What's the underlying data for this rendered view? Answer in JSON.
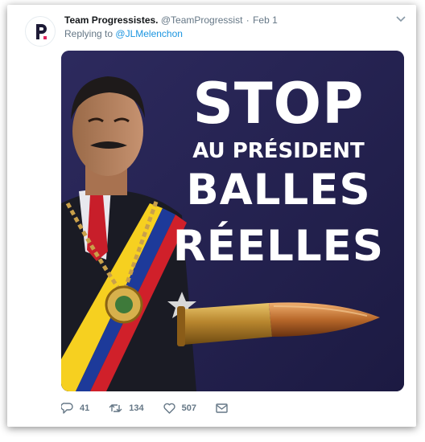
{
  "tweet": {
    "author_name": "Team Progressistes.",
    "handle": "@TeamProgressist",
    "separator": "·",
    "date": "Feb 1",
    "replying_prefix": "Replying to",
    "replying_to": "@JLMelenchon",
    "image_text": {
      "line1": "STOP",
      "line2": "AU PRÉSIDENT",
      "line3": "BALLES",
      "line4": "RÉELLES"
    },
    "actions": {
      "replies": "41",
      "retweets": "134",
      "likes": "507"
    }
  },
  "icons": {
    "avatar": "p-logo",
    "menu": "chevron-down-icon",
    "reply": "reply-icon",
    "retweet": "retweet-icon",
    "like": "heart-icon",
    "dm": "envelope-icon"
  },
  "colors": {
    "link": "#1b95e0",
    "muted": "#657786",
    "name": "#14171a",
    "image_background": "#24224f"
  }
}
